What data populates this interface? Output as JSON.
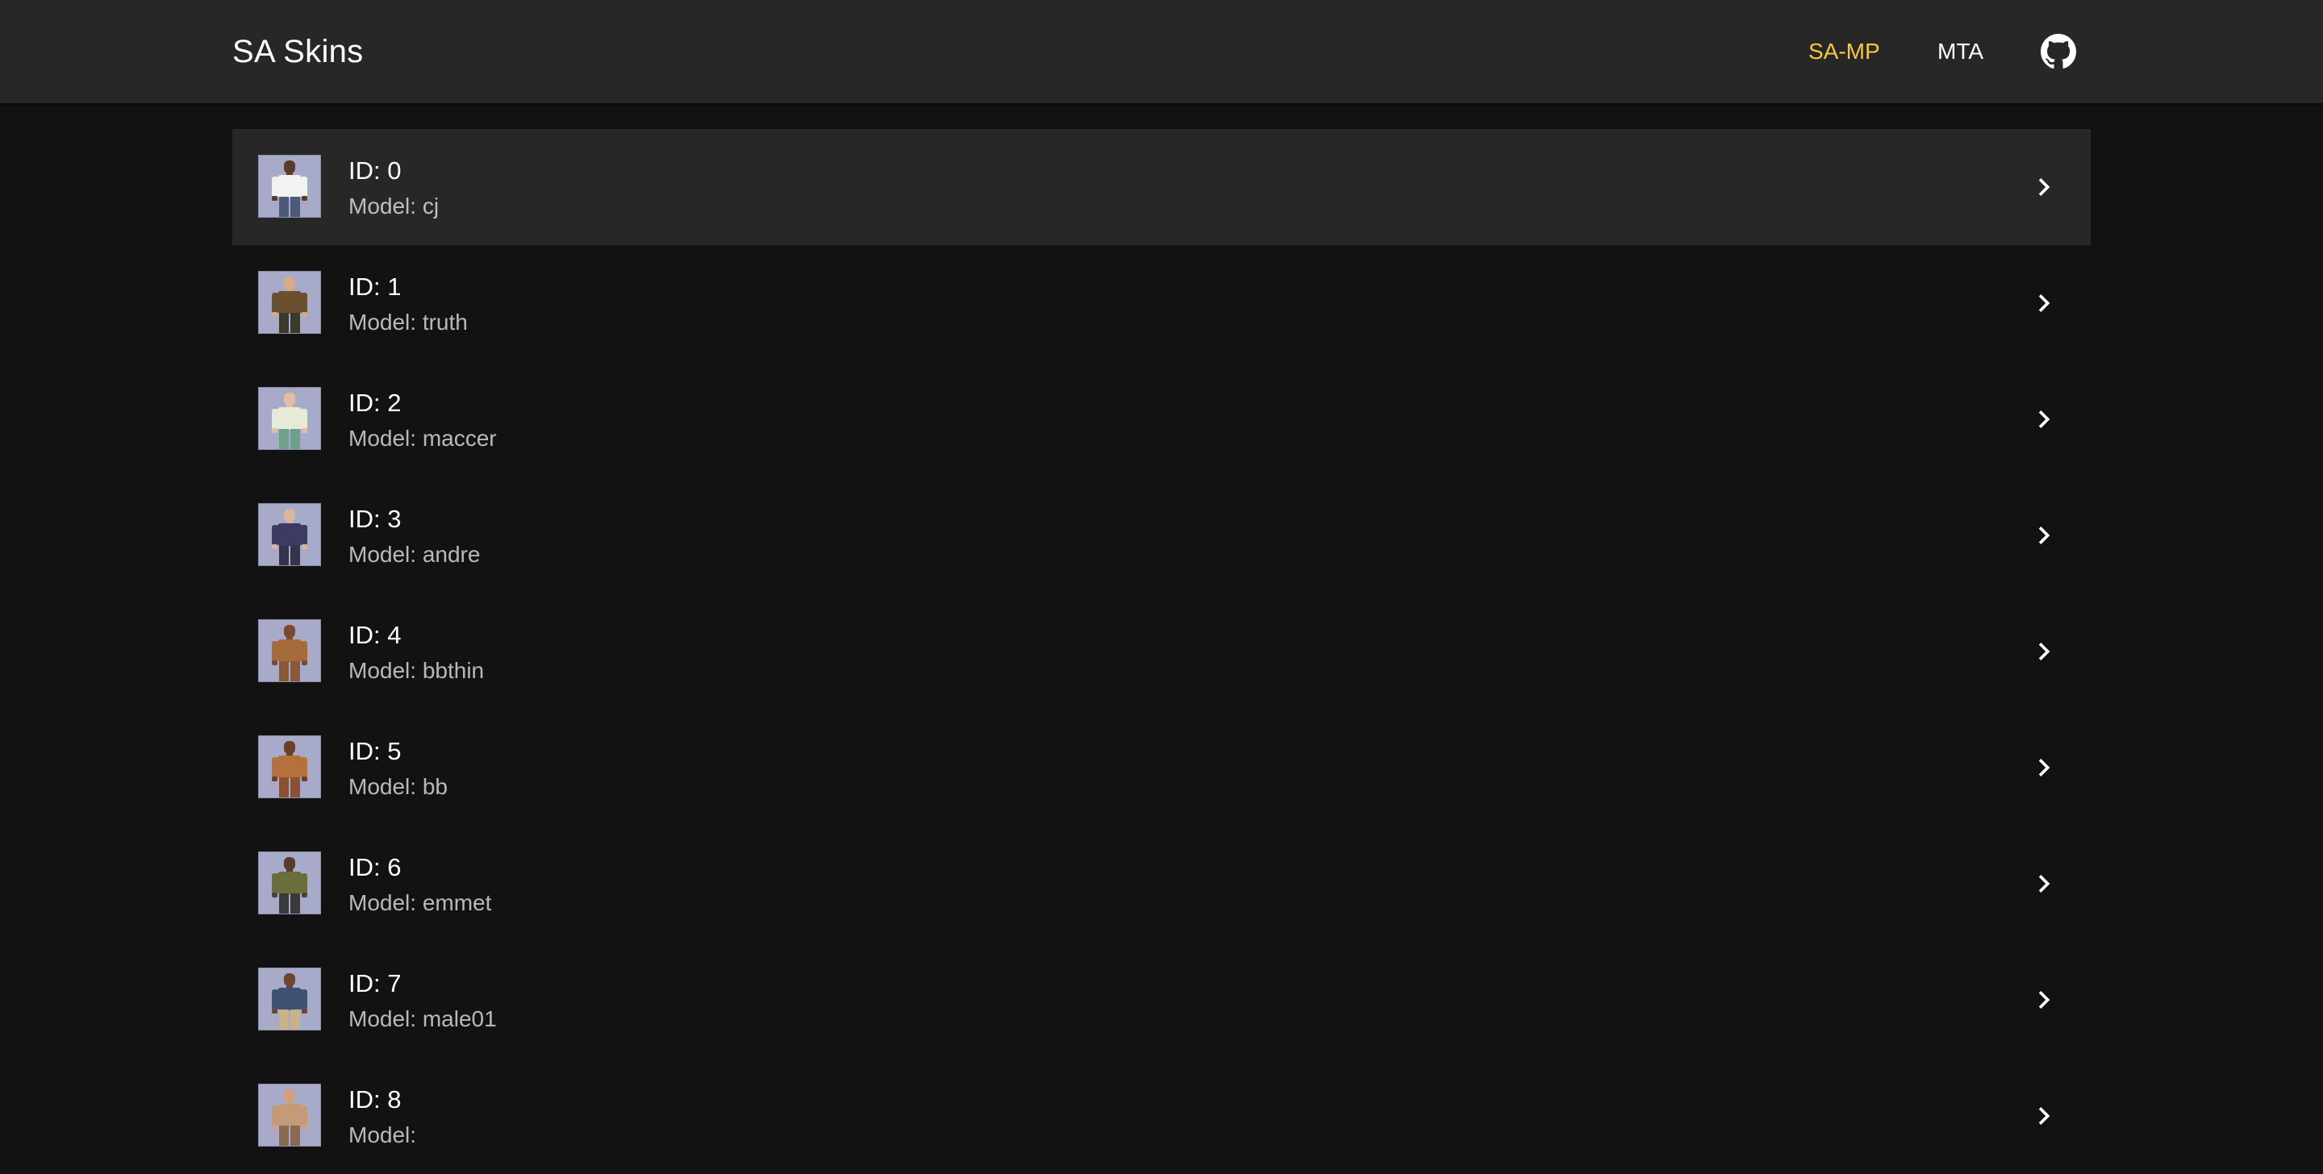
{
  "header": {
    "title": "SA Skins",
    "nav": [
      {
        "label": "SA-MP",
        "active": true
      },
      {
        "label": "MTA",
        "active": false
      }
    ],
    "github_icon": "github-icon",
    "active_color": "#f9c83a"
  },
  "skins": [
    {
      "id_text": "ID: 0",
      "model_text": "Model: cj",
      "selected": true,
      "shirt": "#f2f2f2",
      "legs": "#4a5a78",
      "skin": "#5a3a28"
    },
    {
      "id_text": "ID: 1",
      "model_text": "Model: truth",
      "selected": false,
      "shirt": "#6b5030",
      "legs": "#3a3a2a",
      "skin": "#d9a988"
    },
    {
      "id_text": "ID: 2",
      "model_text": "Model: maccer",
      "selected": false,
      "shirt": "#e8ead8",
      "legs": "#6fa08c",
      "skin": "#e0c0a0"
    },
    {
      "id_text": "ID: 3",
      "model_text": "Model: andre",
      "selected": false,
      "shirt": "#3c3c62",
      "legs": "#34344f",
      "skin": "#d8b79a"
    },
    {
      "id_text": "ID: 4",
      "model_text": "Model: bbthin",
      "selected": false,
      "shirt": "#a66a3c",
      "legs": "#8a5a36",
      "skin": "#7a4a30"
    },
    {
      "id_text": "ID: 5",
      "model_text": "Model: bb",
      "selected": false,
      "shirt": "#b5703c",
      "legs": "#8a5232",
      "skin": "#6a4028"
    },
    {
      "id_text": "ID: 6",
      "model_text": "Model: emmet",
      "selected": false,
      "shirt": "#6b6e3a",
      "legs": "#3a3a3a",
      "skin": "#5a3a28"
    },
    {
      "id_text": "ID: 7",
      "model_text": "Model: male01",
      "selected": false,
      "shirt": "#3e5170",
      "legs": "#c8b28a",
      "skin": "#6a4530"
    },
    {
      "id_text": "ID: 8",
      "model_text": "Model: ",
      "selected": false,
      "shirt": "#c49a78",
      "legs": "#8a6a50",
      "skin": "#d0a080"
    }
  ],
  "icons": {
    "row_action": "chevron-right-icon",
    "thumbnail": "skin-thumbnail"
  }
}
